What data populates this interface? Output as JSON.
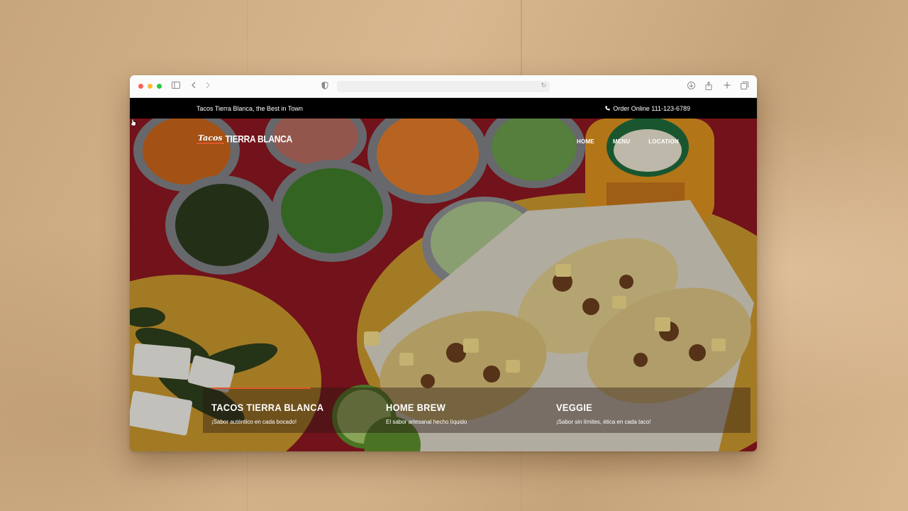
{
  "browser": {
    "url": ""
  },
  "site": {
    "topbar": {
      "tagline": "Tacos Tierra Blanca, the Best in Town",
      "order": "Order Online 111-123-6789"
    },
    "logo": {
      "script": "Tacos",
      "name": "TIERRA BLANCA"
    },
    "nav": [
      {
        "label": "HOME"
      },
      {
        "label": "MENU"
      },
      {
        "label": "LOCATION"
      }
    ],
    "cards": [
      {
        "title": "TACOS  TIERRA BLANCA",
        "subtitle": "¡Sabor auténtico en cada bocado!"
      },
      {
        "title": "HOME BREW",
        "subtitle": "El sabor artesanal hecho líquido"
      },
      {
        "title": "VEGGIE",
        "subtitle": "¡Sabor sin límites, ética en cada taco!"
      }
    ]
  },
  "colors": {
    "accent": "#e0572a",
    "topbar": "#000000",
    "hero_red": "#8e1822"
  }
}
